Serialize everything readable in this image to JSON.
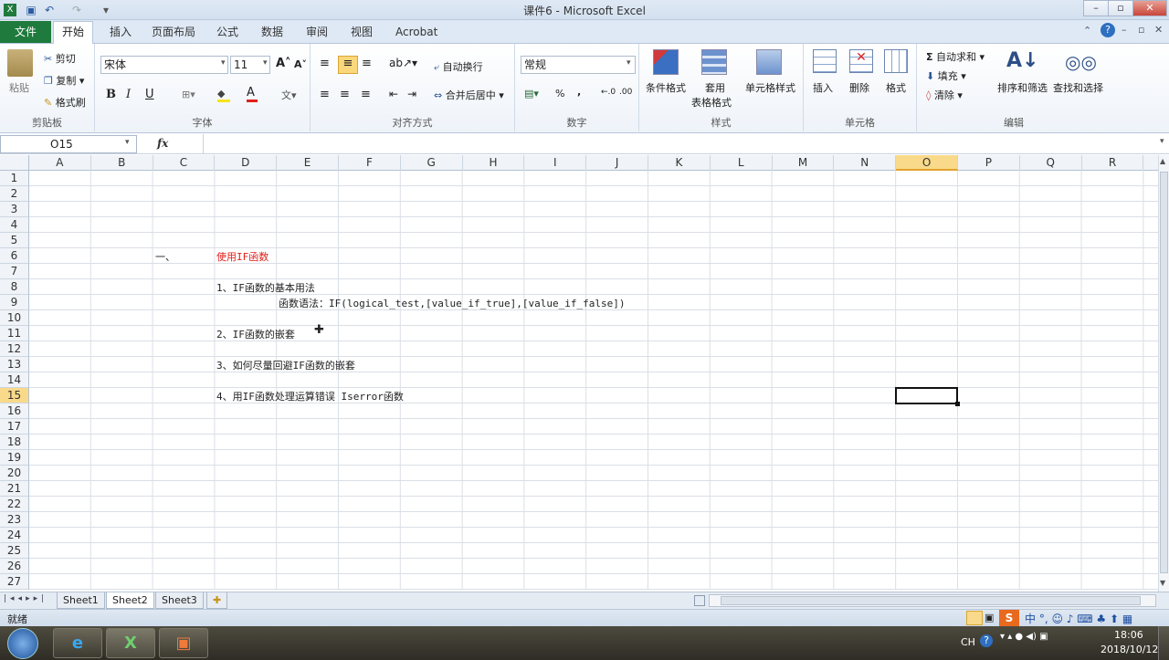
{
  "window": {
    "title": "课件6 - Microsoft Excel",
    "controls": [
      "–",
      "▫",
      "✕"
    ]
  },
  "quick_access": {
    "save_icon": "save-icon",
    "undo_icon": "undo-icon",
    "redo_icon": "redo-icon"
  },
  "ribbon_tabs": [
    {
      "label": "文件"
    },
    {
      "label": "开始"
    },
    {
      "label": "插入"
    },
    {
      "label": "页面布局"
    },
    {
      "label": "公式"
    },
    {
      "label": "数据"
    },
    {
      "label": "审阅"
    },
    {
      "label": "视图"
    },
    {
      "label": "Acrobat"
    }
  ],
  "clipboard": {
    "paste": "粘贴",
    "cut": "剪切",
    "copy": "复制",
    "format_painter": "格式刷",
    "group": "剪贴板"
  },
  "font": {
    "name": "宋体",
    "size": "11",
    "bold": "B",
    "italic": "I",
    "underline": "U",
    "group": "字体"
  },
  "alignment": {
    "wrap": "自动换行",
    "merge": "合并后居中",
    "group": "对齐方式"
  },
  "number": {
    "format": "常规",
    "percent": "%",
    "comma": ",",
    "group": "数字"
  },
  "styles": {
    "conditional": "条件格式",
    "table_a": "套用",
    "table_b": "表格格式",
    "cell_styles": "单元格样式",
    "group": "样式"
  },
  "cells": {
    "insert": "插入",
    "delete": "删除",
    "format": "格式",
    "group": "单元格"
  },
  "editing": {
    "autosum": "自动求和",
    "fill": "填充",
    "clear": "清除",
    "sort": "排序和筛选",
    "find": "查找和选择",
    "group": "编辑"
  },
  "formula_bar": {
    "name_box": "O15",
    "fx": "fx",
    "value": ""
  },
  "columns": [
    "A",
    "B",
    "C",
    "D",
    "E",
    "F",
    "G",
    "H",
    "I",
    "J",
    "K",
    "L",
    "M",
    "N",
    "O",
    "P",
    "Q",
    "R"
  ],
  "selected_column": "O",
  "rows": [
    "1",
    "2",
    "3",
    "4",
    "5",
    "6",
    "7",
    "8",
    "9",
    "10",
    "11",
    "12",
    "13",
    "14",
    "15",
    "16",
    "17",
    "18",
    "19",
    "20",
    "21",
    "22",
    "23",
    "24",
    "25",
    "26",
    "27"
  ],
  "selected_row": "15",
  "cells_content": {
    "c6": "一、",
    "d6": "使用IF函数",
    "d8": "1、IF函数的基本用法",
    "e9": "函数语法：IF(logical_test,[value_if_true],[value_if_false])",
    "d11": "2、IF函数的嵌套",
    "d13": "3、如何尽量回避IF函数的嵌套",
    "d15": "4、用IF函数处理运算错误  Iserror函数"
  },
  "accent_red": "#e0201b",
  "sheets": [
    {
      "label": "Sheet1"
    },
    {
      "label": "Sheet2"
    },
    {
      "label": "Sheet3"
    }
  ],
  "active_sheet": "Sheet2",
  "status": {
    "mode": "就绪"
  },
  "taskbar": {
    "lang": "CH",
    "time": "18:06",
    "date": "2018/10/12"
  }
}
